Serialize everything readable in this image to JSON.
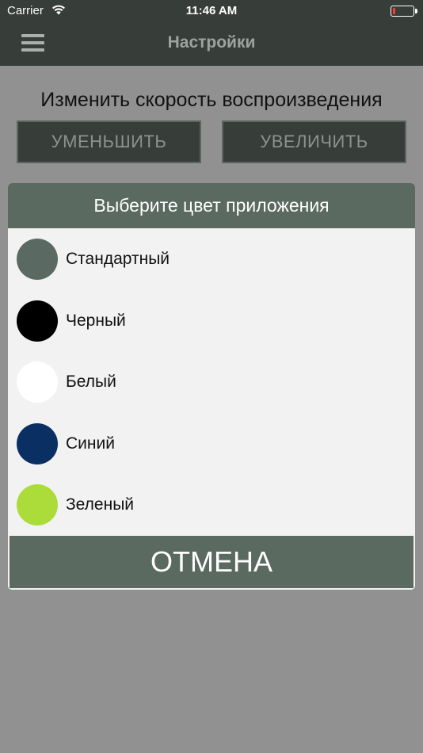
{
  "status_bar": {
    "carrier": "Carrier",
    "time": "11:46 AM",
    "battery_level": 0.15,
    "battery_color": "#ff3b30"
  },
  "nav": {
    "menu_icon": "hamburger-menu-icon",
    "title": "Настройки"
  },
  "speed": {
    "title": "Изменить скорость воспроизведения",
    "decrease_label": "УМЕНЬШИТЬ",
    "increase_label": "УВЕЛИЧИТЬ"
  },
  "color_dialog": {
    "title": "Выберите цвет приложения",
    "options": [
      {
        "label": "Стандартный",
        "color": "#5a6a62"
      },
      {
        "label": "Черный",
        "color": "#000000"
      },
      {
        "label": "Белый",
        "color": "#ffffff"
      },
      {
        "label": "Синий",
        "color": "#0a2f63"
      },
      {
        "label": "Зеленый",
        "color": "#abdc3a"
      }
    ],
    "cancel_label": "ОТМЕНА"
  }
}
